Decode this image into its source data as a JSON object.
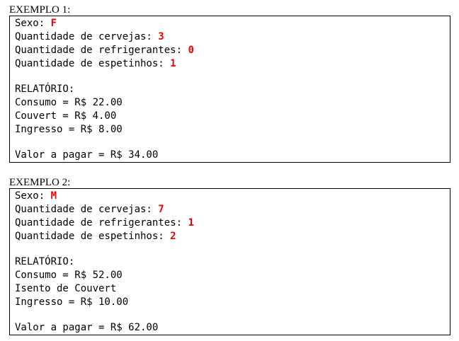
{
  "examples": [
    {
      "title": "EXEMPLO 1:",
      "inputs": [
        {
          "label": "Sexo: ",
          "value": "F"
        },
        {
          "label": "Quantidade de cervejas: ",
          "value": "3"
        },
        {
          "label": "Quantidade de refrigerantes: ",
          "value": "0"
        },
        {
          "label": "Quantidade de espetinhos: ",
          "value": "1"
        }
      ],
      "report": [
        "RELATÓRIO:",
        "Consumo = R$ 22.00",
        "Couvert = R$ 4.00",
        "Ingresso = R$ 8.00"
      ],
      "total": "Valor a pagar = R$ 34.00"
    },
    {
      "title": "EXEMPLO 2:",
      "inputs": [
        {
          "label": "Sexo: ",
          "value": "M"
        },
        {
          "label": "Quantidade de cervejas: ",
          "value": "7"
        },
        {
          "label": "Quantidade de refrigerantes: ",
          "value": "1"
        },
        {
          "label": "Quantidade de espetinhos: ",
          "value": "2"
        }
      ],
      "report": [
        "RELATÓRIO:",
        "Consumo = R$ 52.00",
        "Isento de Couvert",
        "Ingresso = R$ 10.00"
      ],
      "total": "Valor a pagar = R$ 62.00"
    }
  ]
}
